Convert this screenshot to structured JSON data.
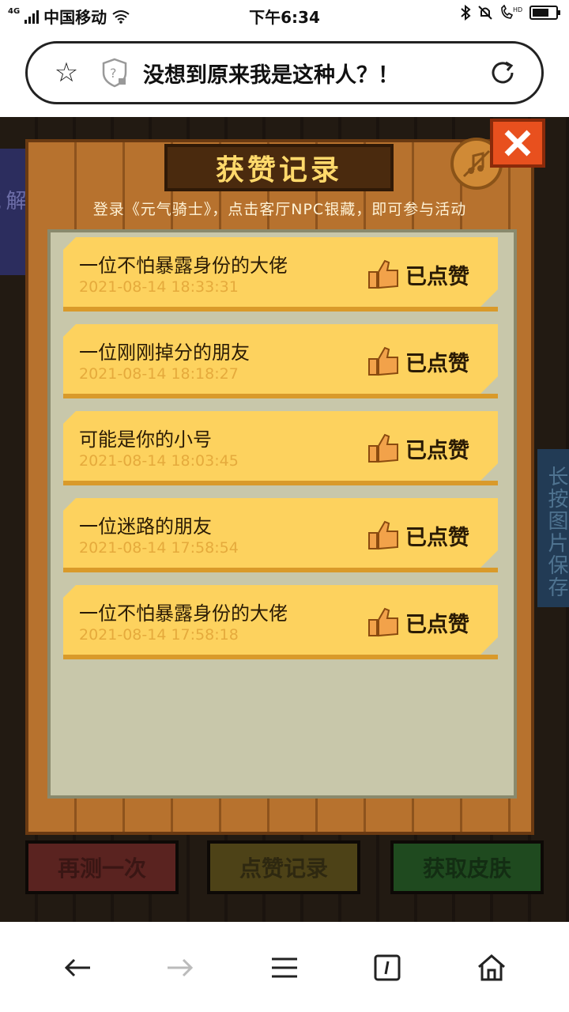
{
  "status_bar": {
    "network_type": "4G",
    "carrier": "中国移动",
    "time": "下午6:34",
    "battery_percent": 70
  },
  "address_bar": {
    "page_title": "没想到原来我是这种人？！"
  },
  "side_tags": {
    "left": "解 流 双",
    "right": "长按图片保存"
  },
  "dialog": {
    "title": "获赞记录",
    "subtitle": "登录《元气骑士》，点击客厅NPC银藏，即可参与活动",
    "records": [
      {
        "name": "一位不怕暴露身份的大佬",
        "time": "2021-08-14 18:33:31",
        "status": "已点赞"
      },
      {
        "name": "一位刚刚掉分的朋友",
        "time": "2021-08-14 18:18:27",
        "status": "已点赞"
      },
      {
        "name": "可能是你的小号",
        "time": "2021-08-14 18:03:45",
        "status": "已点赞"
      },
      {
        "name": "一位迷路的朋友",
        "time": "2021-08-14 17:58:54",
        "status": "已点赞"
      },
      {
        "name": "一位不怕暴露身份的大佬",
        "time": "2021-08-14 17:58:18",
        "status": "已点赞"
      }
    ]
  },
  "game_buttons": {
    "retry": "再测一次",
    "like_records": "点赞记录",
    "get_skin": "获取皮肤"
  },
  "colors": {
    "record_bg": "#fdd25e",
    "title_text": "#ffd96b",
    "wood": "#b7722e",
    "close_red": "#e8501e"
  }
}
